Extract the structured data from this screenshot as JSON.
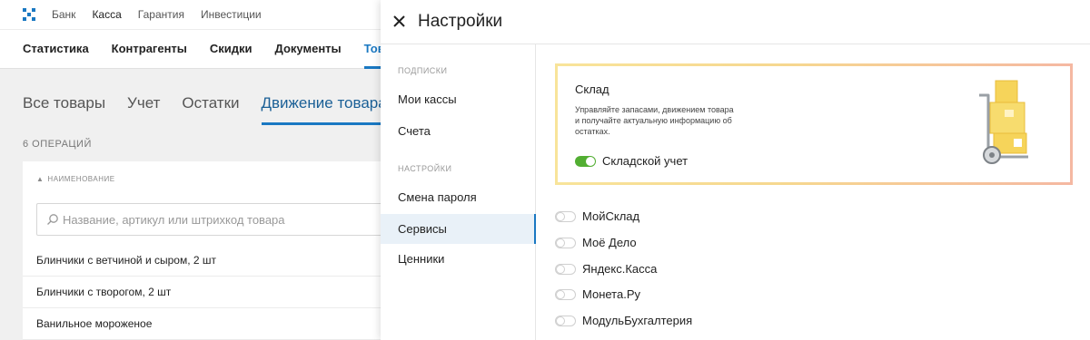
{
  "topbar": {
    "logo_colors": [
      "#1a78c2",
      "#52ae32",
      "#1a78c2",
      "#52ae32",
      "#1a78c2",
      "#52ae32",
      "#1a78c2",
      "#52ae32",
      "#1a78c2"
    ],
    "items": [
      {
        "label": "Банк"
      },
      {
        "label": "Касса"
      },
      {
        "label": "Гарантия"
      },
      {
        "label": "Инвестиции"
      }
    ],
    "active_index": 1
  },
  "mainnav": {
    "items": [
      {
        "label": "Статистика"
      },
      {
        "label": "Контрагенты"
      },
      {
        "label": "Скидки"
      },
      {
        "label": "Документы"
      },
      {
        "label": "Товары"
      }
    ],
    "active_index": 4
  },
  "subtabs": {
    "items": [
      {
        "label": "Все товары"
      },
      {
        "label": "Учет"
      },
      {
        "label": "Остатки"
      },
      {
        "label": "Движение товара"
      }
    ],
    "active_index": 3
  },
  "operations_count": "6 ОПЕРАЦИЙ",
  "table": {
    "column_header": "НАИМЕНОВАНИЕ",
    "search_placeholder": "Название, артикул или штрихкод товара",
    "rows": [
      {
        "name": "Блинчики с ветчиной и сыром, 2 шт"
      },
      {
        "name": "Блинчики с творогом, 2 шт"
      },
      {
        "name": "Ванильное мороженое"
      }
    ]
  },
  "panel": {
    "title": "Настройки",
    "sidebar": {
      "group_subscriptions": "ПОДПИСКИ",
      "group_settings": "НАСТРОЙКИ",
      "items": [
        {
          "label": "Мои кассы"
        },
        {
          "label": "Счета"
        },
        {
          "label": "Смена пароля"
        },
        {
          "label": "Сервисы"
        },
        {
          "label": "Ценники"
        }
      ],
      "active_index": 3
    },
    "warehouse_card": {
      "title": "Склад",
      "description": "Управляйте запасами, движением товара и получайте актуальную информацию об остатках.",
      "toggle_label": "Складской учет",
      "toggle_on": true
    },
    "services": [
      {
        "label": "МойСклад",
        "on": false
      },
      {
        "label": "Моё Дело",
        "on": false
      },
      {
        "label": "Яндекс.Касса",
        "on": false
      },
      {
        "label": "Монета.Ру",
        "on": false
      },
      {
        "label": "МодульБухгалтерия",
        "on": false
      }
    ]
  },
  "colors": {
    "accent": "#1a78c2",
    "toggle_on": "#52ae32",
    "card_gradient_start": "#f8e49a",
    "card_gradient_end": "#f5b8a2"
  }
}
